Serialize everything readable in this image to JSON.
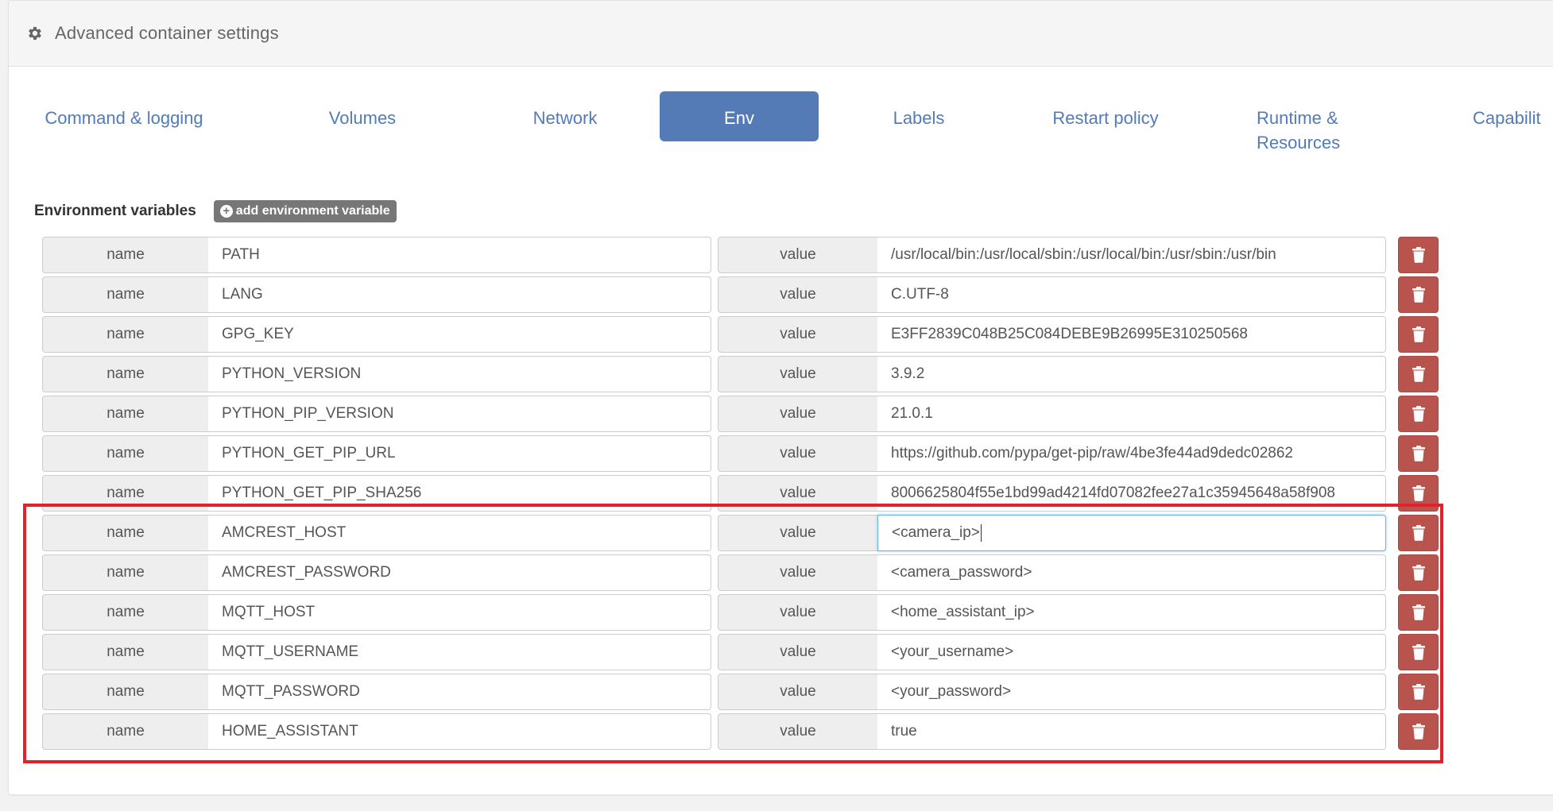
{
  "panel": {
    "title": "Advanced container settings",
    "icon": "gear-icon"
  },
  "tabs": [
    {
      "label": "Command & logging",
      "active": false
    },
    {
      "label": "Volumes",
      "active": false
    },
    {
      "label": "Network",
      "active": false
    },
    {
      "label": "Env",
      "active": true
    },
    {
      "label": "Labels",
      "active": false
    },
    {
      "label": "Restart policy",
      "active": false
    },
    {
      "label": "Runtime & Resources",
      "active": false
    },
    {
      "label": "Capabilit",
      "active": false
    }
  ],
  "env": {
    "section_title": "Environment variables",
    "add_button_label": "add environment variable",
    "name_label": "name",
    "value_label": "value",
    "variables": [
      {
        "name": "PATH",
        "value": "/usr/local/bin:/usr/local/sbin:/usr/local/bin:/usr/sbin:/usr/bin"
      },
      {
        "name": "LANG",
        "value": "C.UTF-8"
      },
      {
        "name": "GPG_KEY",
        "value": "E3FF2839C048B25C084DEBE9B26995E310250568"
      },
      {
        "name": "PYTHON_VERSION",
        "value": "3.9.2"
      },
      {
        "name": "PYTHON_PIP_VERSION",
        "value": "21.0.1"
      },
      {
        "name": "PYTHON_GET_PIP_URL",
        "value": "https://github.com/pypa/get-pip/raw/4be3fe44ad9dedc02862"
      },
      {
        "name": "PYTHON_GET_PIP_SHA256",
        "value": "8006625804f55e1bd99ad4214fd07082fee27a1c35945648a58f908"
      },
      {
        "name": "AMCREST_HOST",
        "value": "<camera_ip>",
        "focused": true
      },
      {
        "name": "AMCREST_PASSWORD",
        "value": "<camera_password>"
      },
      {
        "name": "MQTT_HOST",
        "value": "<home_assistant_ip>"
      },
      {
        "name": "MQTT_USERNAME",
        "value": "<your_username>"
      },
      {
        "name": "MQTT_PASSWORD",
        "value": "<your_password>"
      },
      {
        "name": "HOME_ASSISTANT",
        "value": "true"
      }
    ]
  },
  "colors": {
    "accent": "#547bb6",
    "danger": "#b9534e",
    "highlight": "#e4202a"
  }
}
